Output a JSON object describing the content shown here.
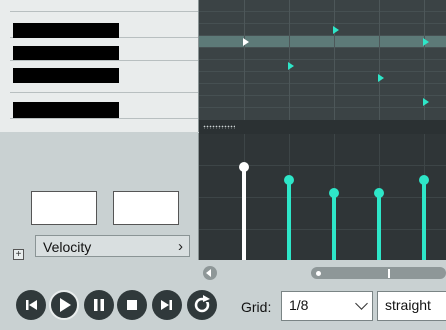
{
  "controls": {
    "cc_lane": "Velocity",
    "grid_label": "Grid:",
    "grid_value": "1/8",
    "swing_value": "straight"
  },
  "colors": {
    "note": "#2ee6c8",
    "selected_note": "#ffffff",
    "velocity_bar": "#2ee6c8",
    "selected_velocity": "#ffffff"
  },
  "icons": [
    "go-to-start-icon",
    "play-icon",
    "pause-icon",
    "stop-icon",
    "go-to-end-icon",
    "repeat-icon"
  ],
  "notes": [
    {
      "pitch_row": 3,
      "beat": 0.55,
      "selected": true
    },
    {
      "pitch_row": 2,
      "beat": 1.55,
      "selected": false
    },
    {
      "pitch_row": 5,
      "beat": 1.05,
      "selected": false
    },
    {
      "pitch_row": 6,
      "beat": 2.05,
      "selected": false
    },
    {
      "pitch_row": 3,
      "beat": 2.55,
      "selected": false
    },
    {
      "pitch_row": 8,
      "beat": 2.55,
      "selected": false
    }
  ],
  "velocities": [
    {
      "value": 106,
      "selected": true
    },
    {
      "value": 91,
      "selected": false
    },
    {
      "value": 76,
      "selected": false
    },
    {
      "value": 76,
      "selected": false
    },
    {
      "value": 91,
      "selected": false
    }
  ]
}
